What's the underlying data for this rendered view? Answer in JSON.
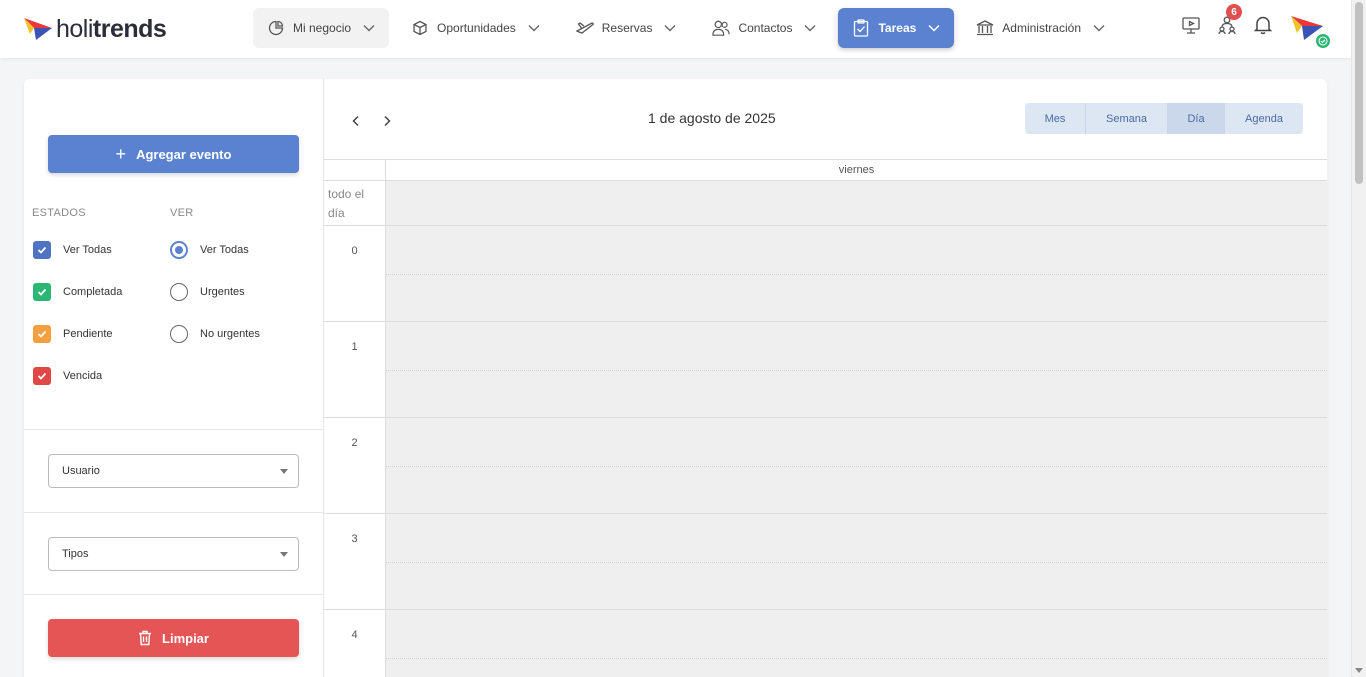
{
  "brand": {
    "logo_light": "holi",
    "logo_bold": "trends"
  },
  "nav": {
    "items": [
      {
        "label": "Mi negocio",
        "icon": "pie-chart-icon"
      },
      {
        "label": "Oportunidades",
        "icon": "box-icon"
      },
      {
        "label": "Reservas",
        "icon": "plane-icon"
      },
      {
        "label": "Contactos",
        "icon": "users-icon"
      },
      {
        "label": "Tareas",
        "icon": "clipboard-check-icon"
      },
      {
        "label": "Administración",
        "icon": "bank-icon"
      }
    ],
    "active": "Tareas"
  },
  "header": {
    "notifications_count": "6"
  },
  "sidebar": {
    "add_event_label": "Agregar evento",
    "states_title": "ESTADOS",
    "view_title": "VER",
    "states": [
      {
        "label": "Ver Todas",
        "color": "#4f74c4",
        "checked": true
      },
      {
        "label": "Completada",
        "color": "#2bb673",
        "checked": true
      },
      {
        "label": "Pendiente",
        "color": "#f5a040",
        "checked": true
      },
      {
        "label": "Vencida",
        "color": "#e04848",
        "checked": true
      }
    ],
    "view_options": [
      {
        "label": "Ver Todas",
        "selected": true
      },
      {
        "label": "Urgentes",
        "selected": false
      },
      {
        "label": "No urgentes",
        "selected": false
      }
    ],
    "user_select": "Usuario",
    "types_select": "Tipos",
    "clear_label": "Limpiar"
  },
  "calendar": {
    "title": "1 de agosto de 2025",
    "views": [
      "Mes",
      "Semana",
      "Día",
      "Agenda"
    ],
    "selected_view": "Día",
    "day_header": "viernes",
    "all_day_label": "todo el día",
    "hours": [
      "0",
      "1",
      "2",
      "3",
      "4"
    ]
  },
  "colors": {
    "accent": "#5b82d0",
    "danger": "#e55555"
  }
}
